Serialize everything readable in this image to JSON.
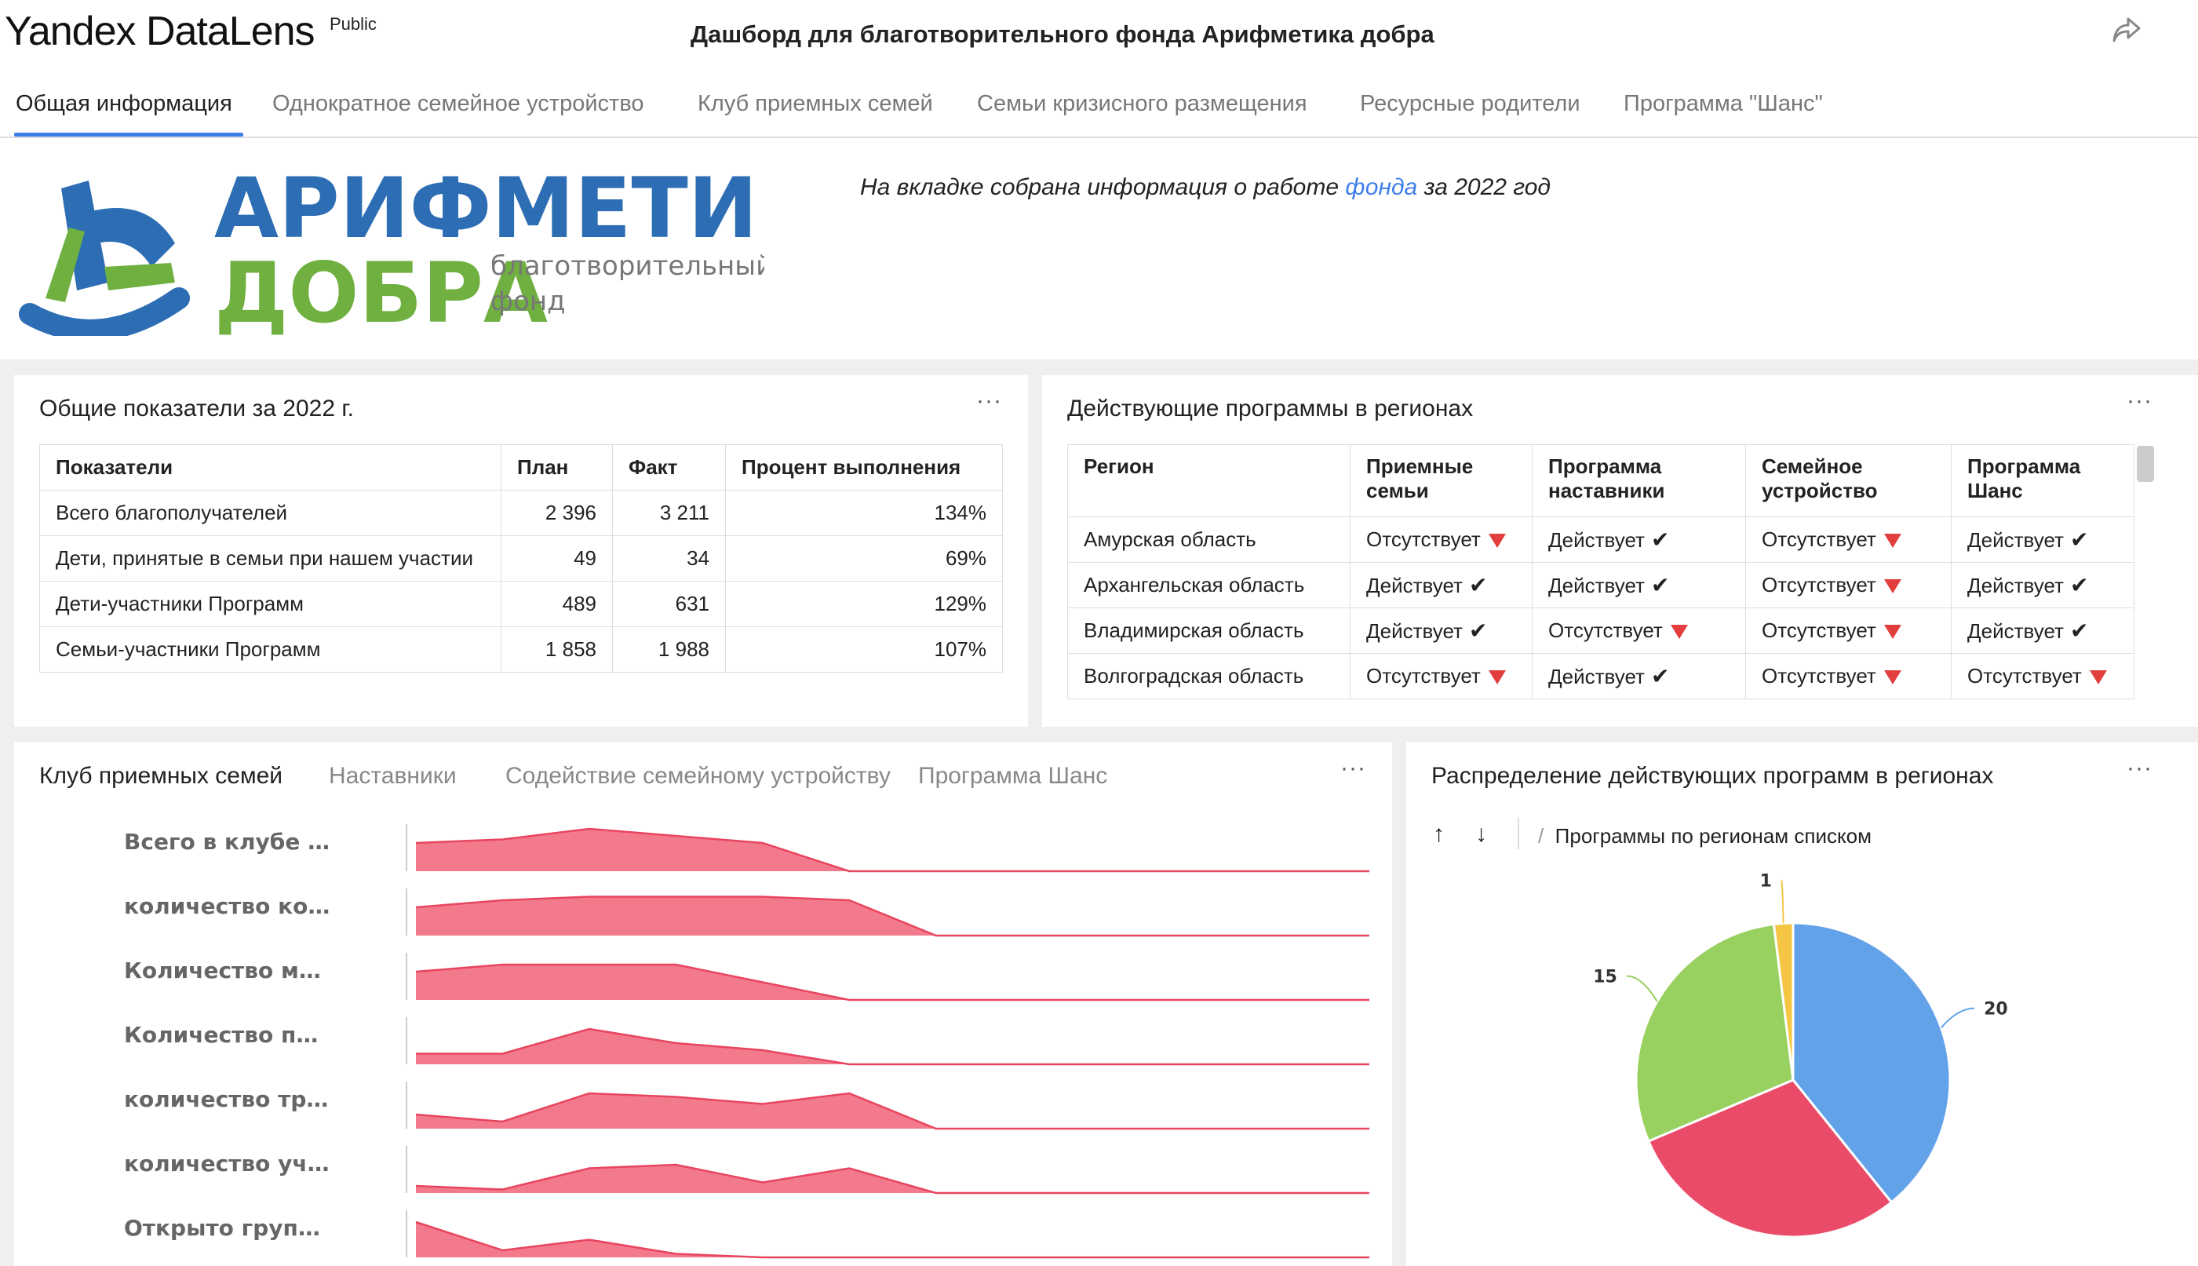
{
  "header": {
    "brand": "Yandex DataLens",
    "brand_tag": "Public",
    "title": "Дашборд для благотворительного фонда Арифметика добра"
  },
  "tabs": [
    {
      "label": "Общая информация",
      "active": true
    },
    {
      "label": "Однократное семейное устройство",
      "active": false
    },
    {
      "label": "Клуб приемных семей",
      "active": false
    },
    {
      "label": "Семьи кризисного размещения",
      "active": false
    },
    {
      "label": "Ресурсные родители",
      "active": false
    },
    {
      "label": "Программа \"Шанс\"",
      "active": false
    }
  ],
  "intro": {
    "logo_line1": "АРИФМЕТИКА",
    "logo_line2": "ДОБРА",
    "logo_sub1": "благотворительный",
    "logo_sub2": "фонд",
    "text_before": "На вкладке собрана информация о работе ",
    "text_link": "фонда",
    "text_after": " за 2022 год"
  },
  "kpi_panel": {
    "title": "Общие показатели за 2022 г.",
    "columns": [
      "Показатели",
      "План",
      "Факт",
      "Процент выполнения"
    ],
    "rows": [
      [
        "Всего благополучателей",
        "2 396",
        "3 211",
        "134%"
      ],
      [
        "Дети, принятые в семьи при нашем участии",
        "49",
        "34",
        "69%"
      ],
      [
        "Дети-участники Программ",
        "489",
        "631",
        "129%"
      ],
      [
        "Семьи-участники Программ",
        "1 858",
        "1 988",
        "107%"
      ]
    ]
  },
  "regions_panel": {
    "title": "Действующие программы в регионах",
    "columns": [
      [
        "Регион",
        ""
      ],
      [
        "Приемные",
        "семьи"
      ],
      [
        "Программа",
        "наставники"
      ],
      [
        "Семейное",
        "устройство"
      ],
      [
        "Программа",
        "Шанс"
      ]
    ],
    "rows": [
      [
        "Амурская область",
        "Отсутствует",
        "Действует",
        "Отсутствует",
        "Действует"
      ],
      [
        "Архангельская область",
        "Действует",
        "Действует",
        "Отсутствует",
        "Действует"
      ],
      [
        "Владимирская область",
        "Действует",
        "Отсутствует",
        "Отсутствует",
        "Действует"
      ],
      [
        "Волгоградская область",
        "Отсутствует",
        "Действует",
        "Отсутствует",
        "Отсутствует"
      ]
    ],
    "active_label": "Действует",
    "absent_label": "Отсутствует"
  },
  "club_panel": {
    "tabs": [
      {
        "label": "Клуб приемных семей",
        "active": true
      },
      {
        "label": "Наставники",
        "active": false
      },
      {
        "label": "Содействие семейному устройству",
        "active": false
      },
      {
        "label": "Программа Шанс",
        "active": false
      }
    ],
    "accent_color": "#e8455e",
    "fill_color": "#f27a8c",
    "rows": [
      {
        "label": "Всего в клубе …",
        "values": [
          8,
          9,
          12,
          10,
          8,
          0,
          0,
          0,
          0,
          0,
          0,
          0
        ]
      },
      {
        "label": "количество ко…",
        "values": [
          8,
          10,
          11,
          11,
          11,
          10,
          0,
          0,
          0,
          0,
          0,
          0
        ]
      },
      {
        "label": "Количество м…",
        "values": [
          8,
          10,
          10,
          10,
          5,
          0,
          0,
          0,
          0,
          0,
          0,
          0
        ]
      },
      {
        "label": "Количество п…",
        "values": [
          3,
          3,
          10,
          6,
          4,
          0,
          0,
          0,
          0,
          0,
          0,
          0
        ]
      },
      {
        "label": "количество тр…",
        "values": [
          4,
          2,
          10,
          9,
          7,
          10,
          0,
          0,
          0,
          0,
          0,
          0
        ]
      },
      {
        "label": "количество уч…",
        "values": [
          2,
          1,
          7,
          8,
          3,
          7,
          0,
          0,
          0,
          0,
          0,
          0
        ]
      },
      {
        "label": "Открыто груп…",
        "values": [
          10,
          2,
          5,
          1,
          0,
          0,
          0,
          0,
          0,
          0,
          0,
          0
        ]
      }
    ]
  },
  "pie_panel": {
    "title": "Распределение действующих программ в регионах",
    "breadcrumb": "Программы по регионам списком",
    "chart_data": {
      "type": "pie",
      "values": [
        20,
        15,
        15,
        1
      ],
      "labels_shown": [
        "20",
        "",
        "15",
        "1"
      ],
      "colors": [
        "#62a2e8",
        "#ea4b68",
        "#98d160",
        "#f4c644"
      ]
    }
  }
}
